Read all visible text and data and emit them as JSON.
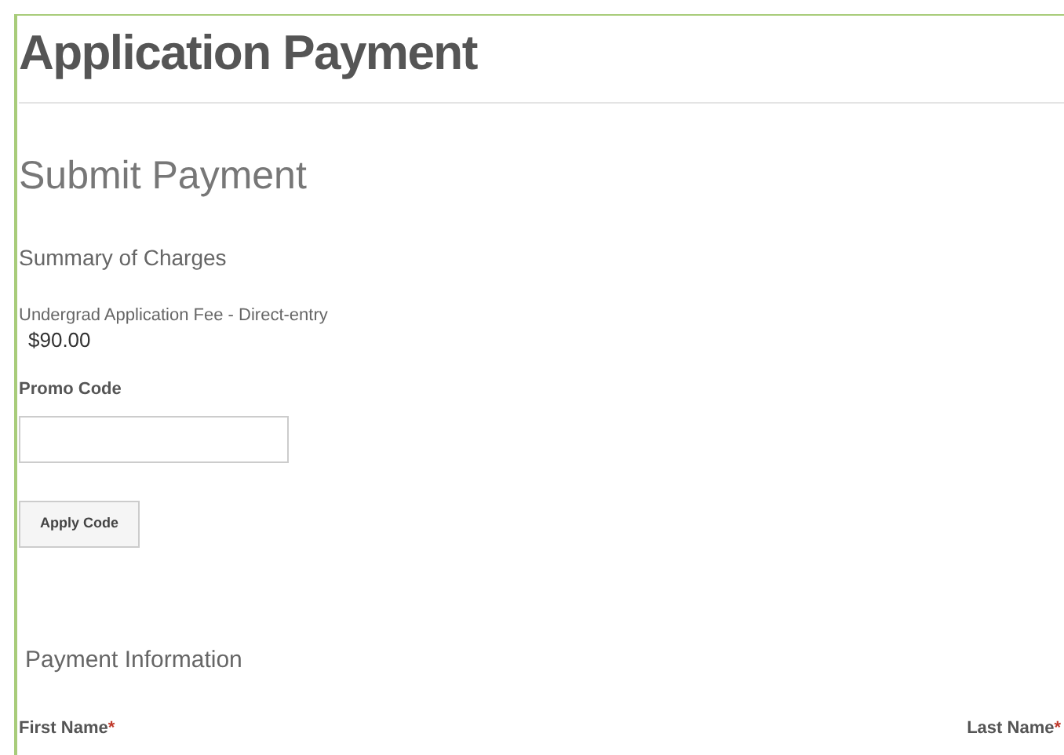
{
  "page_title": "Application Payment",
  "section_title": "Submit Payment",
  "summary": {
    "heading": "Summary of Charges",
    "items": [
      {
        "description": "Undergrad Application Fee - Direct-entry",
        "amount": "$90.00"
      }
    ]
  },
  "promo": {
    "label": "Promo Code",
    "button": "Apply Code"
  },
  "payment": {
    "heading": "Payment Information",
    "fields": [
      {
        "label": "First Name",
        "required_mark": "*"
      },
      {
        "label": "Last Name",
        "required_mark": "*"
      }
    ]
  }
}
